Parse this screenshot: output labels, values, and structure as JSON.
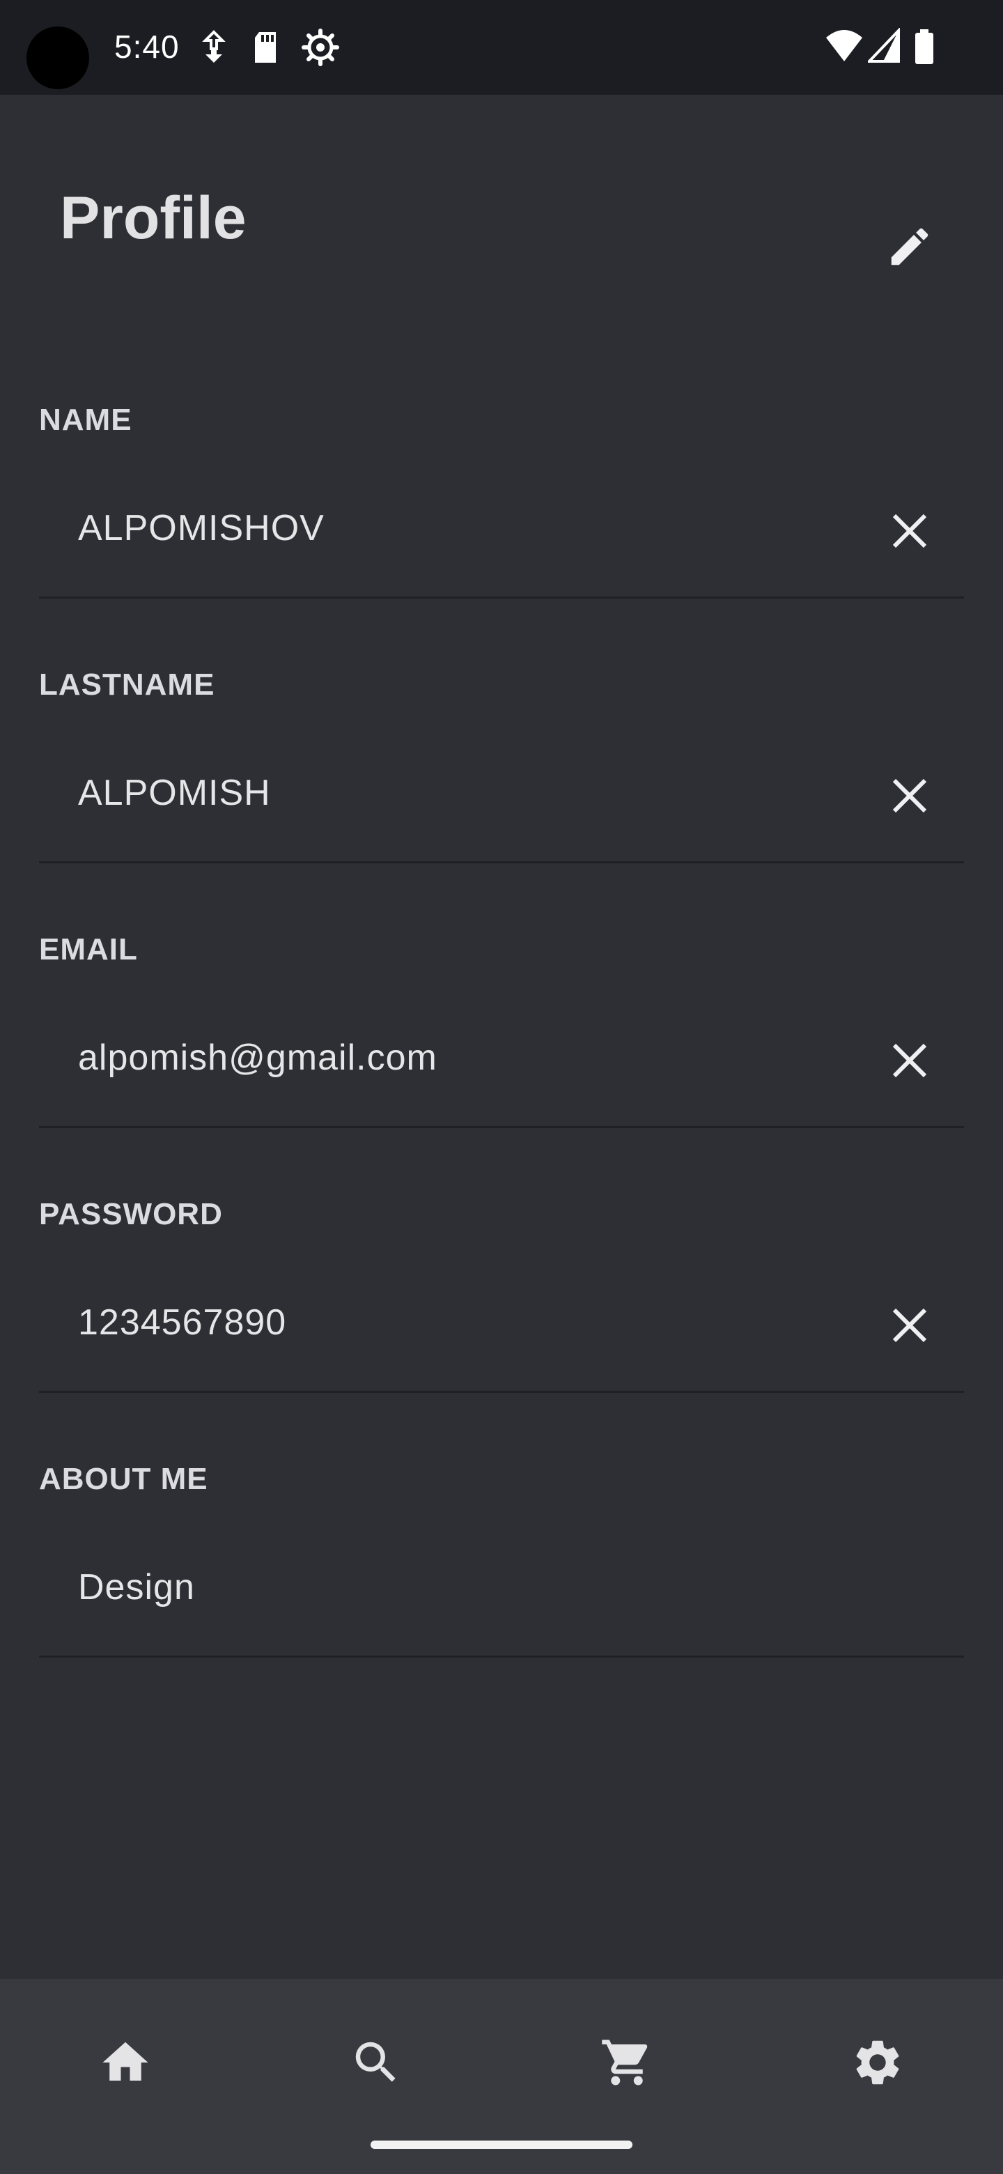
{
  "status_bar": {
    "time": "5:40",
    "icons": [
      "data-saver-icon",
      "sd-card-icon",
      "settings-gear-icon",
      "wifi-icon",
      "cell-signal-icon",
      "battery-icon"
    ]
  },
  "header": {
    "title": "Profile",
    "edit_icon": "pencil-icon"
  },
  "fields": [
    {
      "label": "NAME",
      "value": "ALPOMISHOV",
      "clearable": true
    },
    {
      "label": "LASTNAME",
      "value": "ALPOMISH",
      "clearable": true
    },
    {
      "label": "EMAIL",
      "value": "alpomish@gmail.com",
      "clearable": true
    },
    {
      "label": "PASSWORD",
      "value": "1234567890",
      "clearable": true
    },
    {
      "label": "ABOUT ME",
      "value": "Design",
      "clearable": false
    }
  ],
  "bottom_nav": {
    "items": [
      "home-icon",
      "search-icon",
      "cart-icon",
      "settings-icon"
    ]
  },
  "colors": {
    "background": "#2e2f34",
    "status_bar": "#1c1d22",
    "bottom_nav": "#383a40",
    "text": "#e6e6e8",
    "divider": "#1f2024"
  }
}
